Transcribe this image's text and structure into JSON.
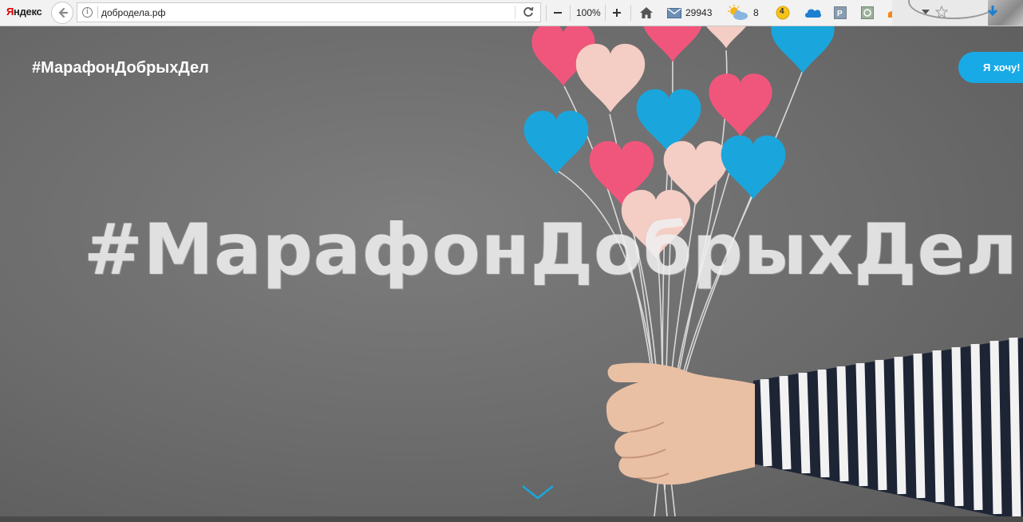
{
  "browser": {
    "brand": {
      "part1": "Я",
      "part2": "ндекс"
    },
    "address": {
      "url": "добродела.рф"
    },
    "zoom": "100%",
    "mail_count": "29943",
    "weather_temp": "8",
    "traffic_level": "4"
  },
  "page": {
    "site_title": "#МарафонДобрыхДел",
    "cta_label": "Я хочу!",
    "hero_text": "#МарафонДобрыхДел"
  },
  "colors": {
    "accent": "#18aae6",
    "heart_pink": "#f0567c",
    "heart_blue": "#1aa6dc",
    "heart_peach": "#f4cdc4"
  }
}
